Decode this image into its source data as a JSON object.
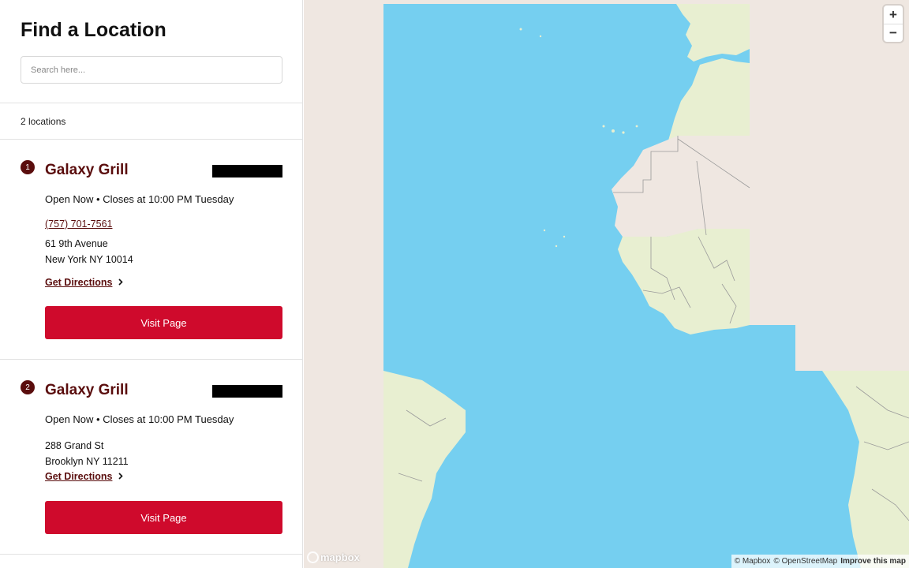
{
  "header": {
    "title": "Find a Location",
    "search_placeholder": "Search here..."
  },
  "results": {
    "count_label": "2 locations"
  },
  "locations": [
    {
      "number": "1",
      "name": "Galaxy Grill",
      "hours": "Open Now • Closes at 10:00 PM Tuesday",
      "phone": "(757) 701-7561",
      "address_line1": "61 9th Avenue",
      "address_line2": "New York NY 10014",
      "directions_label": "Get Directions",
      "visit_label": "Visit Page"
    },
    {
      "number": "2",
      "name": "Galaxy Grill",
      "hours": "Open Now • Closes at 10:00 PM Tuesday",
      "address_line1": "288 Grand St",
      "address_line2": "Brooklyn NY 11211",
      "directions_label": "Get Directions",
      "visit_label": "Visit Page"
    }
  ],
  "map": {
    "zoom_in": "+",
    "zoom_out": "−",
    "logo_text": "mapbox",
    "attribution_mapbox": "© Mapbox",
    "attribution_osm": "© OpenStreetMap",
    "improve_label": "Improve this map"
  },
  "colors": {
    "brand": "#5a0d0d",
    "button": "#cf0a2c",
    "ocean": "#75cff0",
    "land": "#e8efd1",
    "desert": "#efe7e1"
  },
  "icons": {
    "directions_chevron": "chevron-right-icon"
  }
}
